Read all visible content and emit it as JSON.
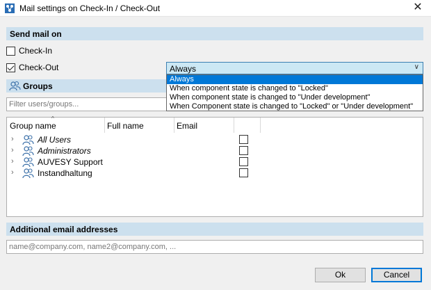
{
  "window": {
    "title": "Mail settings on Check-In / Check-Out",
    "close_glyph": "✕"
  },
  "send_mail": {
    "header": "Send mail on",
    "checkin": {
      "label": "Check-In",
      "checked": false
    },
    "checkout": {
      "label": "Check-Out",
      "checked": true
    },
    "combo": {
      "selected": "Always",
      "arrow_glyph": "∨",
      "options": [
        "Always",
        "When component state is changed to \"Locked\"",
        "When component state is changed to \"Under development\"",
        "When Component state is changed to \"Locked\" or \"Under development\""
      ]
    }
  },
  "groups": {
    "header": "Groups",
    "filter_placeholder": "Filter users/groups...",
    "columns": [
      "Group name",
      "Full name",
      "Email"
    ],
    "sort_glyph": "^",
    "expander_glyph": "›",
    "rows": [
      {
        "name": "All Users",
        "italic": true
      },
      {
        "name": "Administrators",
        "italic": true
      },
      {
        "name": "AUVESY Support",
        "italic": false
      },
      {
        "name": "Instandhaltung",
        "italic": false
      }
    ]
  },
  "additional": {
    "header": "Additional email addresses",
    "placeholder": "name@company.com, name2@company.com, ..."
  },
  "buttons": {
    "ok": "Ok",
    "cancel": "Cancel"
  },
  "icons": {
    "app": "mail-settings-icon",
    "groups": "user-group-icon",
    "row": "user-icon"
  },
  "colors": {
    "accent": "#0078d7",
    "section_header": "#cce0ee",
    "combo_bg": "#cce8f4"
  }
}
